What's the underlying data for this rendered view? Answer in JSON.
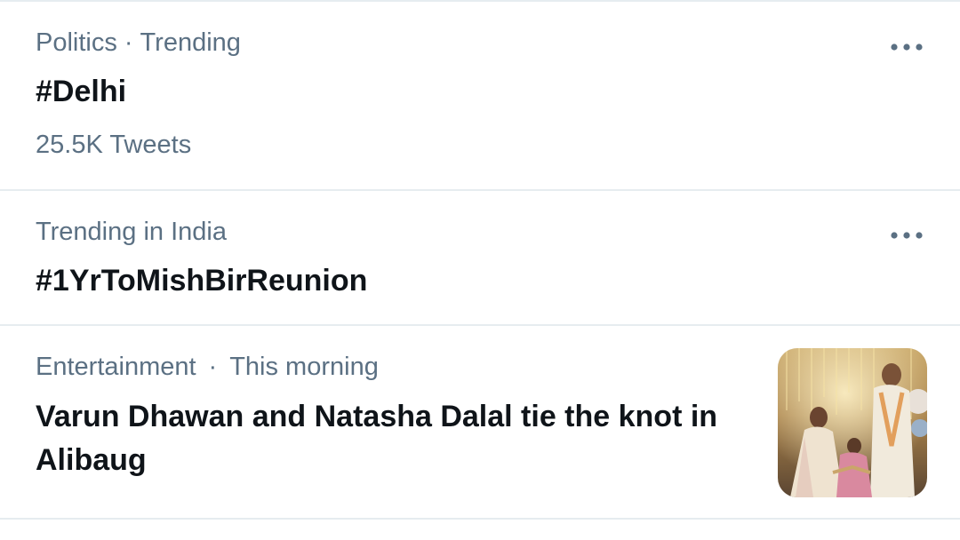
{
  "trends": [
    {
      "category": "Politics",
      "separator": "·",
      "context": "Trending",
      "title": "#Delhi",
      "count": "25.5K Tweets",
      "more_icon": "more-dots-icon"
    },
    {
      "context": "Trending in India",
      "title": "#1YrToMishBirReunion",
      "more_icon": "more-dots-icon"
    }
  ],
  "news": {
    "category": "Entertainment",
    "separator": "·",
    "time": "This morning",
    "headline": "Varun Dhawan and Natasha Dalal tie the knot in Alibaug",
    "image": "wedding-photo"
  },
  "colors": {
    "secondary_text": "#5b7083",
    "primary_text": "#0f1419",
    "divider": "#e6ecf0"
  }
}
